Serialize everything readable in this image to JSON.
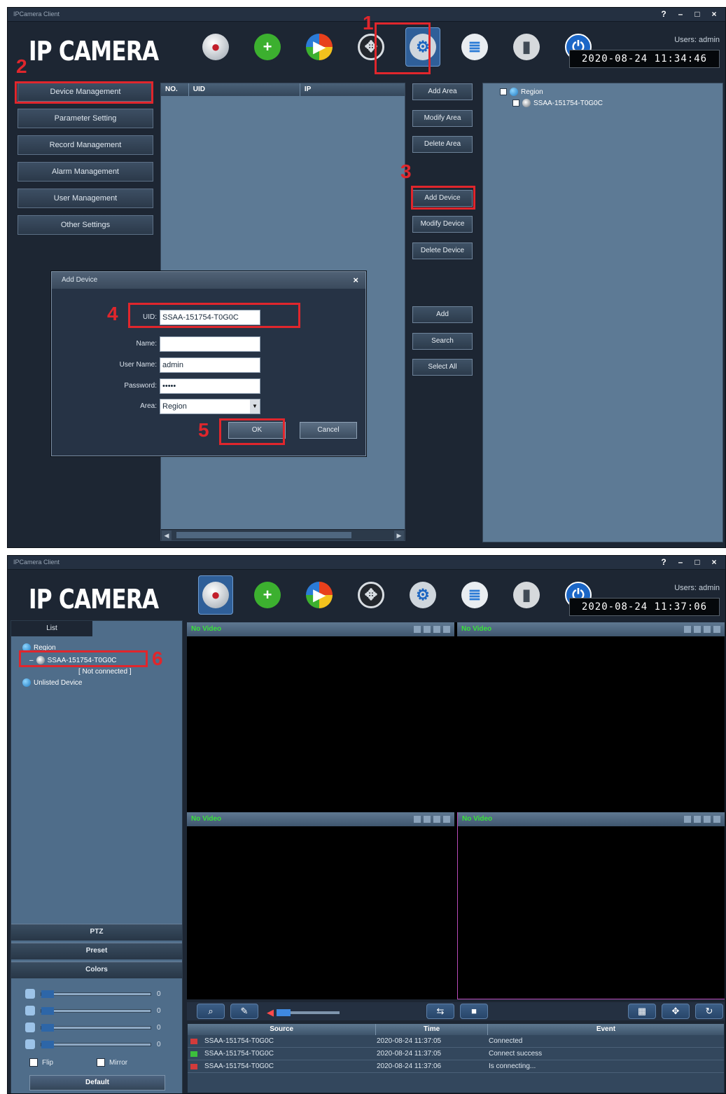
{
  "window1": {
    "titlebar": {
      "title": "IPCamera Client",
      "help": "?",
      "minimize": "–",
      "maximize": "□",
      "close": "×"
    },
    "logo": "IP CAMERA",
    "user": "Users: admin",
    "clock": "2020-08-24 11:34:46",
    "toolbar": [
      "camera-view",
      "add-device",
      "playback",
      "ptz",
      "settings",
      "log",
      "lock",
      "power"
    ],
    "active_tool": "settings",
    "menu": [
      "Device Management",
      "Parameter Setting",
      "Record Management",
      "Alarm Management",
      "User Management",
      "Other Settings"
    ],
    "list_columns": [
      "NO.",
      "UID",
      "IP"
    ],
    "buttons": [
      "Add Area",
      "Modify Area",
      "Delete Area",
      "Add Device",
      "Modify Device",
      "Delete Device",
      "Add",
      "Search",
      "Select All"
    ],
    "tree": {
      "root": "Region",
      "child": "SSAA-151754-T0G0C"
    },
    "dialog": {
      "title": "Add Device",
      "close": "×",
      "uid_label": "UID:",
      "uid_value": "SSAA-151754-T0G0C",
      "name_label": "Name:",
      "name_value": "",
      "user_label": "User Name:",
      "user_value": "admin",
      "password_label": "Password:",
      "password_value": "•••••",
      "area_label": "Area:",
      "area_value": "Region",
      "ok": "OK",
      "cancel": "Cancel"
    },
    "scroll_left": "◀",
    "scroll_right": "▶"
  },
  "window2": {
    "titlebar": {
      "title": "IPCamera Client",
      "help": "?",
      "minimize": "–",
      "maximize": "□",
      "close": "×"
    },
    "logo": "IP CAMERA",
    "user": "Users: admin",
    "clock": "2020-08-24 11:37:06",
    "tab": "List",
    "tree": {
      "root": "Region",
      "device": "SSAA-151754-T0G0C",
      "status": "[ Not connected ]",
      "other": "Unlisted Device"
    },
    "sections": [
      "PTZ",
      "Preset",
      "Colors"
    ],
    "sliders": [
      {
        "icon": "brightness",
        "value": "0"
      },
      {
        "icon": "contrast",
        "value": "0"
      },
      {
        "icon": "saturation",
        "value": "0"
      },
      {
        "icon": "hue",
        "value": "0"
      }
    ],
    "flip": "Flip",
    "mirror": "Mirror",
    "default": "Default",
    "video_label": "No Video",
    "events": {
      "columns": [
        "Source",
        "Time",
        "Event"
      ],
      "rows": [
        {
          "source": "SSAA-151754-T0G0C",
          "time": "2020-08-24 11:37:05",
          "event": "Connected",
          "lamp": "#d23b3b"
        },
        {
          "source": "SSAA-151754-T0G0C",
          "time": "2020-08-24 11:37:05",
          "event": "Connect success",
          "lamp": "#3cbf3c"
        },
        {
          "source": "SSAA-151754-T0G0C",
          "time": "2020-08-24 11:37:06",
          "event": "Is connecting...",
          "lamp": "#d23b3b"
        }
      ]
    }
  },
  "steps": [
    "1",
    "2",
    "3",
    "4",
    "5",
    "6"
  ],
  "colors": {
    "accent": "#e0262c",
    "panel": "#5d7a95",
    "video_label": "#39e33b"
  }
}
